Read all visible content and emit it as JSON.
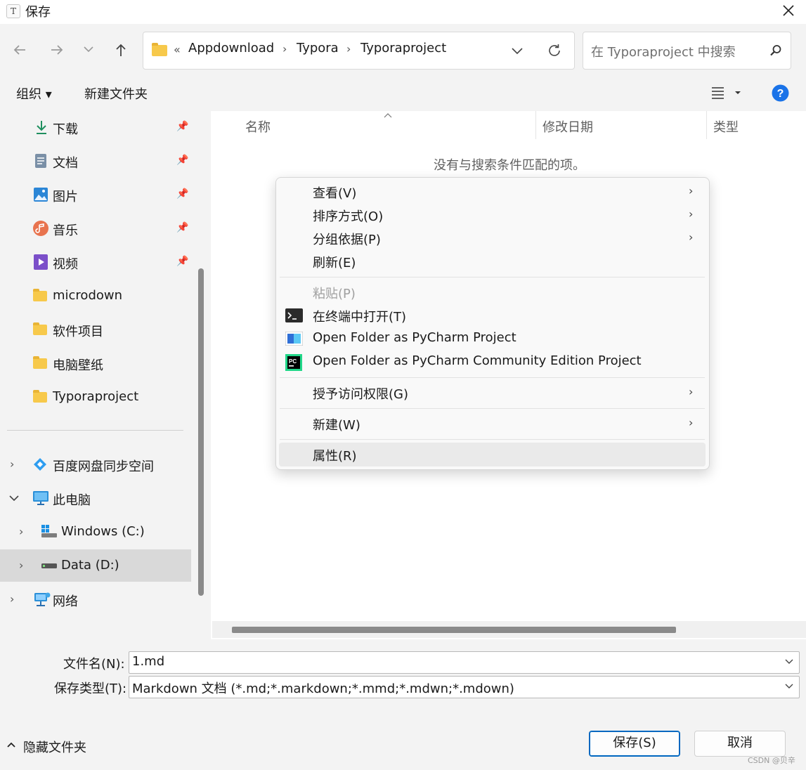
{
  "window": {
    "title": "保存",
    "app_icon_letter": "T"
  },
  "nav": {
    "address": {
      "overflow": "«",
      "crumbs": [
        "Appdownload",
        "Typora",
        "Typoraproject"
      ]
    },
    "search_placeholder": "在 Typoraproject 中搜索"
  },
  "commandbar": {
    "organize": "组织 ▾",
    "new_folder": "新建文件夹"
  },
  "sidebar": {
    "quick": [
      {
        "label": "下载",
        "icon": "download-icon"
      },
      {
        "label": "文档",
        "icon": "document-icon"
      },
      {
        "label": "图片",
        "icon": "pictures-icon"
      },
      {
        "label": "音乐",
        "icon": "music-icon"
      },
      {
        "label": "视频",
        "icon": "video-icon"
      },
      {
        "label": "microdown",
        "icon": "folder-icon"
      },
      {
        "label": "软件项目",
        "icon": "folder-icon"
      },
      {
        "label": "电脑壁纸",
        "icon": "folder-icon"
      },
      {
        "label": "Typoraproject",
        "icon": "folder-icon"
      }
    ],
    "tree": [
      {
        "label": "百度网盘同步空间",
        "icon": "baidu-netdisk-icon"
      },
      {
        "label": "此电脑",
        "icon": "this-pc-icon"
      },
      {
        "label": "Windows (C:)",
        "icon": "windows-drive-icon"
      },
      {
        "label": "Data (D:)",
        "icon": "drive-icon"
      },
      {
        "label": "网络",
        "icon": "network-icon"
      }
    ]
  },
  "columns": {
    "name": "名称",
    "modified": "修改日期",
    "type": "类型"
  },
  "empty_message": "没有与搜索条件匹配的项。",
  "context_menu": {
    "view": "查看(V)",
    "sort": "排序方式(O)",
    "group": "分组依据(P)",
    "refresh": "刷新(E)",
    "paste": "粘贴(P)",
    "open_terminal": "在终端中打开(T)",
    "pycharm": "Open Folder as PyCharm Project",
    "pycharm_ce": "Open Folder as PyCharm Community Edition Project",
    "grant_access": "授予访问权限(G)",
    "new": "新建(W)",
    "properties": "属性(R)"
  },
  "form": {
    "filename_label": "文件名(N):",
    "filename_value": "1.md",
    "filetype_label": "保存类型(T):",
    "filetype_value": "Markdown 文档 (*.md;*.markdown;*.mmd;*.mdwn;*.mdown)"
  },
  "footer": {
    "hide_folders": "隐藏文件夹",
    "save": "保存(S)",
    "cancel": "取消",
    "watermark": "CSDN @贝辛"
  },
  "colors": {
    "accent": "#0067c0",
    "folder": "#f7c94b",
    "selected_row": "#d9d9d9"
  }
}
